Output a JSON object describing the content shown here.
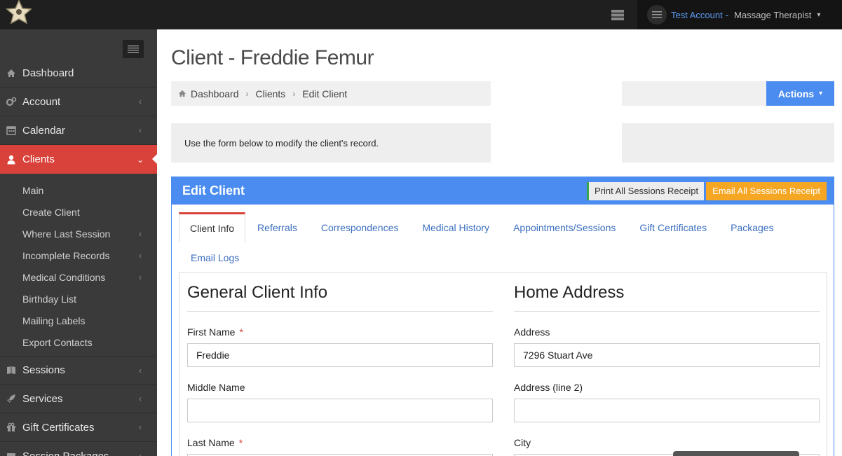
{
  "account": {
    "name": "Test Account",
    "separator": "-",
    "role": "Massage Therapist"
  },
  "sidebar": {
    "items": [
      {
        "label": "Dashboard",
        "icon": "home-icon"
      },
      {
        "label": "Account",
        "icon": "gears-icon"
      },
      {
        "label": "Calendar",
        "icon": "calendar-icon"
      },
      {
        "label": "Clients",
        "icon": "user-icon"
      },
      {
        "label": "Sessions",
        "icon": "book-icon"
      },
      {
        "label": "Services",
        "icon": "rocket-icon"
      },
      {
        "label": "Gift Certificates",
        "icon": "gift-icon"
      },
      {
        "label": "Session Packages",
        "icon": "box-icon"
      }
    ],
    "clients_sub": [
      {
        "label": "Main"
      },
      {
        "label": "Create Client"
      },
      {
        "label": "Where Last Session"
      },
      {
        "label": "Incomplete Records"
      },
      {
        "label": "Medical Conditions"
      },
      {
        "label": "Birthday List"
      },
      {
        "label": "Mailing Labels"
      },
      {
        "label": "Export Contacts"
      }
    ]
  },
  "page": {
    "title": "Client - Freddie Femur",
    "breadcrumb": [
      "Dashboard",
      "Clients",
      "Edit Client"
    ],
    "actions_label": "Actions",
    "info_text": "Use the form below to modify the client's record."
  },
  "panel": {
    "title": "Edit Client",
    "print_label": "Print All Sessions Receipt",
    "email_label": "Email All Sessions Receipt",
    "tabs": [
      "Client Info",
      "Referrals",
      "Correspondences",
      "Medical History",
      "Appointments/Sessions",
      "Gift Certificates",
      "Packages",
      "Email Logs"
    ]
  },
  "form": {
    "left_title": "General Client Info",
    "right_title": "Home Address",
    "required_mark": "*",
    "first_name_label": "First Name",
    "first_name_value": "Freddie",
    "middle_name_label": "Middle Name",
    "middle_name_value": "",
    "last_name_label": "Last Name",
    "address_label": "Address",
    "address_value": "7296 Stuart Ave",
    "address2_label": "Address (line 2)",
    "address2_value": "",
    "city_label": "City"
  },
  "colors": {
    "accent_blue": "#4a8cf0",
    "active_red": "#d9423a",
    "email_orange": "#f5a623",
    "sidebar_bg": "#3a3a3a",
    "topbar_bg": "#1f1f1f"
  }
}
